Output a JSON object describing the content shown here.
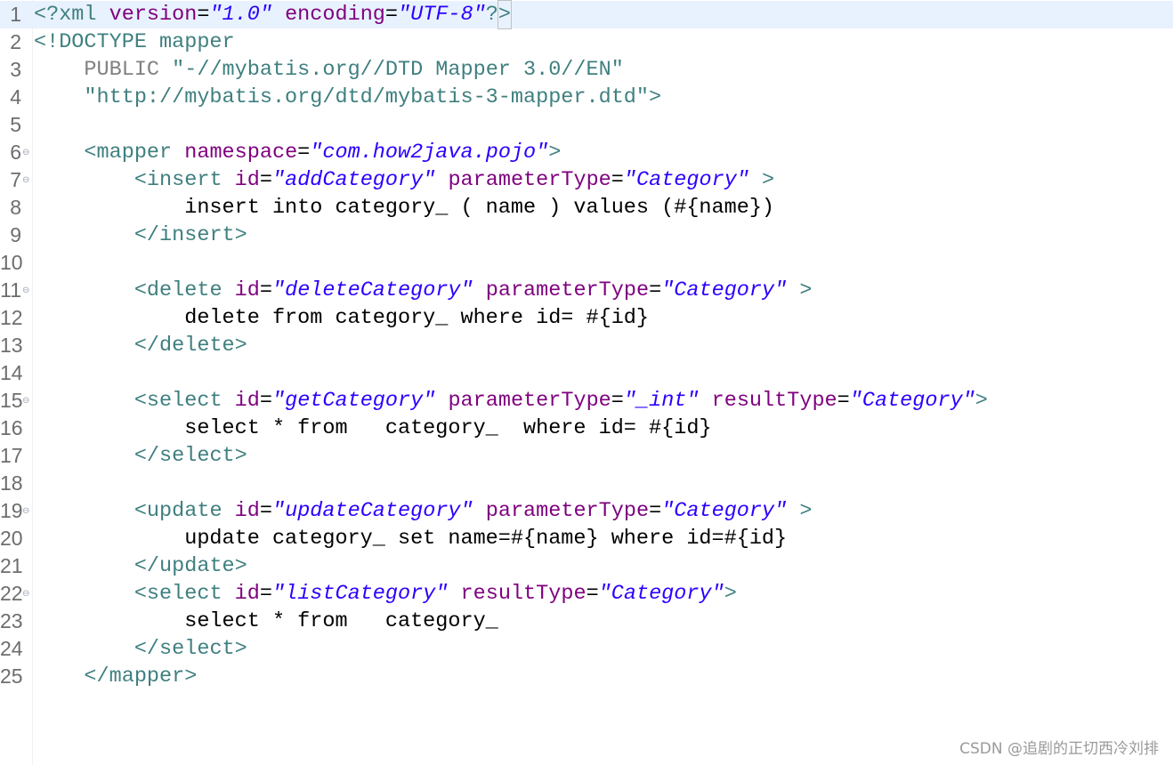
{
  "editor": {
    "lines": [
      {
        "n": "1",
        "fold": false,
        "current": true,
        "tokens": [
          {
            "t": "<?xml ",
            "c": "pi"
          },
          {
            "t": "version",
            "c": "attr"
          },
          {
            "t": "=",
            "c": "plain"
          },
          {
            "t": "\"1.0\"",
            "c": "str"
          },
          {
            "t": " ",
            "c": "plain"
          },
          {
            "t": "encoding",
            "c": "attr"
          },
          {
            "t": "=",
            "c": "plain"
          },
          {
            "t": "\"UTF-8\"",
            "c": "str"
          },
          {
            "t": "?",
            "c": "pi"
          },
          {
            "t": ">",
            "c": "pi-end"
          }
        ]
      },
      {
        "n": "2",
        "fold": false,
        "tokens": [
          {
            "t": "<!DOCTYPE mapper",
            "c": "doctype"
          }
        ]
      },
      {
        "n": "3",
        "fold": false,
        "tokens": [
          {
            "t": "    PUBLIC ",
            "c": "dtd"
          },
          {
            "t": "\"-//mybatis.org//DTD Mapper 3.0//EN\"",
            "c": "dtdstr"
          }
        ]
      },
      {
        "n": "4",
        "fold": false,
        "tokens": [
          {
            "t": "    \"http://mybatis.org/dtd/mybatis-3-mapper.dtd\"",
            "c": "dtdstr"
          },
          {
            "t": ">",
            "c": "doctype"
          }
        ]
      },
      {
        "n": "5",
        "fold": false,
        "tokens": []
      },
      {
        "n": "6",
        "fold": true,
        "tokens": [
          {
            "t": "    ",
            "c": "plain"
          },
          {
            "t": "<mapper ",
            "c": "tag"
          },
          {
            "t": "namespace",
            "c": "attr"
          },
          {
            "t": "=",
            "c": "plain"
          },
          {
            "t": "\"com.how2java.pojo\"",
            "c": "str"
          },
          {
            "t": ">",
            "c": "tag"
          }
        ]
      },
      {
        "n": "7",
        "fold": true,
        "tokens": [
          {
            "t": "        ",
            "c": "plain"
          },
          {
            "t": "<insert ",
            "c": "tag"
          },
          {
            "t": "id",
            "c": "attr"
          },
          {
            "t": "=",
            "c": "plain"
          },
          {
            "t": "\"addCategory\"",
            "c": "str"
          },
          {
            "t": " ",
            "c": "plain"
          },
          {
            "t": "parameterType",
            "c": "attr"
          },
          {
            "t": "=",
            "c": "plain"
          },
          {
            "t": "\"Category\"",
            "c": "str"
          },
          {
            "t": " >",
            "c": "tag"
          }
        ]
      },
      {
        "n": "8",
        "fold": false,
        "tokens": [
          {
            "t": "            insert into category_ ( name ) values (#{name})",
            "c": "plain"
          }
        ]
      },
      {
        "n": "9",
        "fold": false,
        "tokens": [
          {
            "t": "        ",
            "c": "plain"
          },
          {
            "t": "</insert>",
            "c": "tag"
          }
        ]
      },
      {
        "n": "10",
        "fold": false,
        "tokens": []
      },
      {
        "n": "11",
        "fold": true,
        "tokens": [
          {
            "t": "        ",
            "c": "plain"
          },
          {
            "t": "<delete ",
            "c": "tag"
          },
          {
            "t": "id",
            "c": "attr"
          },
          {
            "t": "=",
            "c": "plain"
          },
          {
            "t": "\"deleteCategory\"",
            "c": "str"
          },
          {
            "t": " ",
            "c": "plain"
          },
          {
            "t": "parameterType",
            "c": "attr"
          },
          {
            "t": "=",
            "c": "plain"
          },
          {
            "t": "\"Category\"",
            "c": "str"
          },
          {
            "t": " >",
            "c": "tag"
          }
        ]
      },
      {
        "n": "12",
        "fold": false,
        "tokens": [
          {
            "t": "            delete from category_ where id= #{id}",
            "c": "plain"
          }
        ]
      },
      {
        "n": "13",
        "fold": false,
        "tokens": [
          {
            "t": "        ",
            "c": "plain"
          },
          {
            "t": "</delete>",
            "c": "tag"
          }
        ]
      },
      {
        "n": "14",
        "fold": false,
        "tokens": []
      },
      {
        "n": "15",
        "fold": true,
        "tokens": [
          {
            "t": "        ",
            "c": "plain"
          },
          {
            "t": "<select ",
            "c": "tag"
          },
          {
            "t": "id",
            "c": "attr"
          },
          {
            "t": "=",
            "c": "plain"
          },
          {
            "t": "\"getCategory\"",
            "c": "str"
          },
          {
            "t": " ",
            "c": "plain"
          },
          {
            "t": "parameterType",
            "c": "attr"
          },
          {
            "t": "=",
            "c": "plain"
          },
          {
            "t": "\"_int\"",
            "c": "str"
          },
          {
            "t": " ",
            "c": "plain"
          },
          {
            "t": "resultType",
            "c": "attr"
          },
          {
            "t": "=",
            "c": "plain"
          },
          {
            "t": "\"Category\"",
            "c": "str"
          },
          {
            "t": ">",
            "c": "tag"
          }
        ]
      },
      {
        "n": "16",
        "fold": false,
        "tokens": [
          {
            "t": "            select * from   category_  where id= #{id}",
            "c": "plain"
          }
        ]
      },
      {
        "n": "17",
        "fold": false,
        "tokens": [
          {
            "t": "        ",
            "c": "plain"
          },
          {
            "t": "</select>",
            "c": "tag"
          }
        ]
      },
      {
        "n": "18",
        "fold": false,
        "tokens": []
      },
      {
        "n": "19",
        "fold": true,
        "tokens": [
          {
            "t": "        ",
            "c": "plain"
          },
          {
            "t": "<update ",
            "c": "tag"
          },
          {
            "t": "id",
            "c": "attr"
          },
          {
            "t": "=",
            "c": "plain"
          },
          {
            "t": "\"updateCategory\"",
            "c": "str"
          },
          {
            "t": " ",
            "c": "plain"
          },
          {
            "t": "parameterType",
            "c": "attr"
          },
          {
            "t": "=",
            "c": "plain"
          },
          {
            "t": "\"Category\"",
            "c": "str"
          },
          {
            "t": " >",
            "c": "tag"
          }
        ]
      },
      {
        "n": "20",
        "fold": false,
        "tokens": [
          {
            "t": "            update category_ set name=#{name} where id=#{id}",
            "c": "plain"
          }
        ]
      },
      {
        "n": "21",
        "fold": false,
        "tokens": [
          {
            "t": "        ",
            "c": "plain"
          },
          {
            "t": "</update>",
            "c": "tag"
          }
        ]
      },
      {
        "n": "22",
        "fold": true,
        "tokens": [
          {
            "t": "        ",
            "c": "plain"
          },
          {
            "t": "<select ",
            "c": "tag"
          },
          {
            "t": "id",
            "c": "attr"
          },
          {
            "t": "=",
            "c": "plain"
          },
          {
            "t": "\"listCategory\"",
            "c": "str"
          },
          {
            "t": " ",
            "c": "plain"
          },
          {
            "t": "resultType",
            "c": "attr"
          },
          {
            "t": "=",
            "c": "plain"
          },
          {
            "t": "\"Category\"",
            "c": "str"
          },
          {
            "t": ">",
            "c": "tag"
          }
        ]
      },
      {
        "n": "23",
        "fold": false,
        "tokens": [
          {
            "t": "            select * from   category_",
            "c": "plain"
          }
        ]
      },
      {
        "n": "24",
        "fold": false,
        "tokens": [
          {
            "t": "        ",
            "c": "plain"
          },
          {
            "t": "</select>",
            "c": "tag"
          }
        ]
      },
      {
        "n": "25",
        "fold": false,
        "tokens": [
          {
            "t": "    ",
            "c": "plain"
          },
          {
            "t": "</mapper>",
            "c": "tag"
          }
        ]
      }
    ]
  },
  "icons": {
    "fold": "fold-toggle-icon"
  },
  "watermark": {
    "text": "CSDN @追剧的正切西冷刘排"
  },
  "colors": {
    "tag": "#3f7f7f",
    "attribute": "#7f007f",
    "string": "#2a00ff",
    "current_line": "#e8f2fe"
  }
}
